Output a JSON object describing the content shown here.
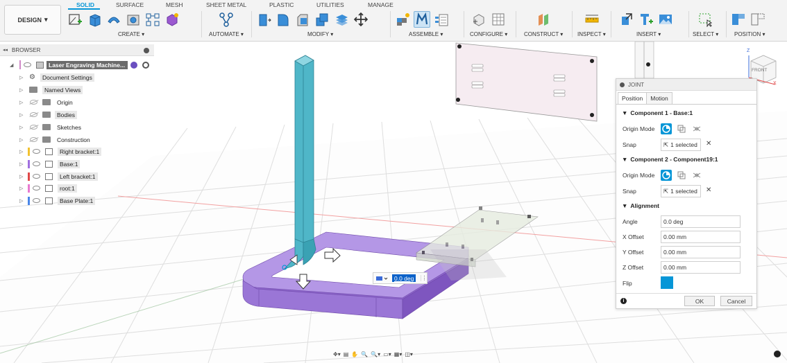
{
  "design_menu": {
    "label": "DESIGN",
    "caret": "▾"
  },
  "tabs": [
    {
      "label": "SOLID",
      "active": true
    },
    {
      "label": "SURFACE"
    },
    {
      "label": "MESH"
    },
    {
      "label": "SHEET METAL"
    },
    {
      "label": "PLASTIC"
    },
    {
      "label": "UTILITIES"
    },
    {
      "label": "MANAGE"
    }
  ],
  "groups": {
    "create": "CREATE ▾",
    "automate": "AUTOMATE ▾",
    "modify": "MODIFY ▾",
    "assemble": "ASSEMBLE ▾",
    "configure": "CONFIGURE ▾",
    "construct": "CONSTRUCT ▾",
    "inspect": "INSPECT ▾",
    "insert": "INSERT ▾",
    "select": "SELECT ▾",
    "position": "POSITION ▾"
  },
  "browser": {
    "title": "BROWSER",
    "collapse_glyph": "◂◂",
    "root": "Laser Engraving Machine...",
    "items": [
      {
        "label": "Document Settings"
      },
      {
        "label": "Named Views"
      },
      {
        "label": "Origin"
      },
      {
        "label": "Bodies"
      },
      {
        "label": "Sketches"
      },
      {
        "label": "Construction"
      },
      {
        "label": "Right bracket:1",
        "color": "#f2c230"
      },
      {
        "label": "Base:1",
        "color": "#a070e0"
      },
      {
        "label": "Left bracket:1",
        "color": "#e04848"
      },
      {
        "label": "root:1",
        "color": "#e87ad0"
      },
      {
        "label": "Base Plate:1",
        "color": "#4a86e8"
      }
    ]
  },
  "viewcube": {
    "face": "FRONT",
    "axis_z": "Z",
    "axis_x": "X"
  },
  "joint": {
    "title": "JOINT",
    "tabs": [
      "Position",
      "Motion"
    ],
    "component1": {
      "header": "Component 1 - Base:1",
      "origin_mode_label": "Origin Mode",
      "snap_label": "Snap",
      "snap_value": "1 selected",
      "clear": "✕"
    },
    "component2": {
      "header": "Component 2 - Component19:1",
      "origin_mode_label": "Origin Mode",
      "snap_label": "Snap",
      "snap_value": "1 selected",
      "clear": "✕"
    },
    "alignment": {
      "header": "Alignment",
      "angle_label": "Angle",
      "angle_value": "0.0 deg",
      "x_label": "X Offset",
      "x_value": "0.00 mm",
      "y_label": "Y Offset",
      "y_value": "0.00 mm",
      "z_label": "Z Offset",
      "z_value": "0.00 mm",
      "flip_label": "Flip"
    },
    "info_glyph": "i",
    "ok": "OK",
    "cancel": "Cancel"
  },
  "canvas_angle_input": {
    "value": "0.0 deg",
    "more": "⋮"
  },
  "navbar": {
    "items": [
      "✥▾",
      "▤",
      "✋",
      "🔍",
      "🔍▾",
      "▭▾",
      "▦▾",
      "◫▾"
    ]
  },
  "colors": {
    "accent": "#0696d7",
    "bracket": "#4fb6c8",
    "base": "#a57fdc",
    "plate": "#f4e8ee"
  }
}
